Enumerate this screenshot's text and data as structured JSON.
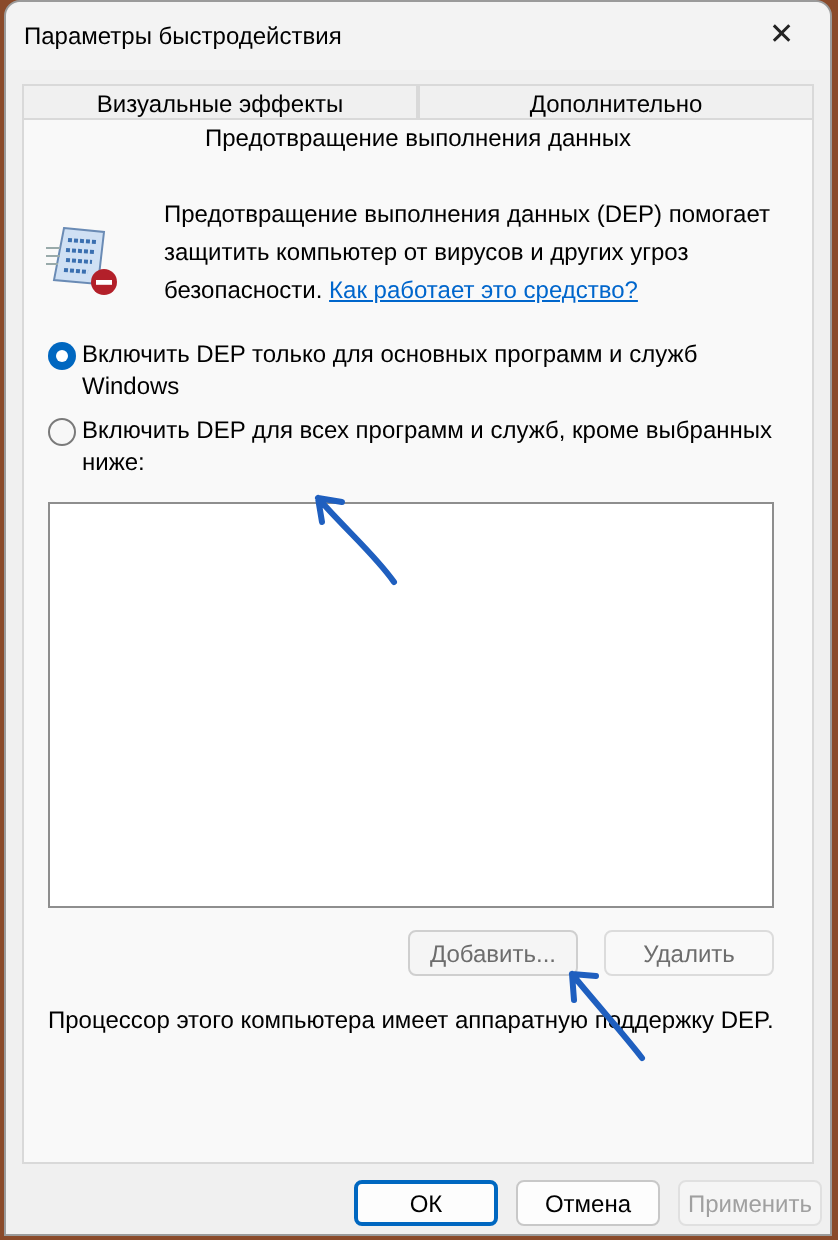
{
  "window": {
    "title": "Параметры быстродействия",
    "close": "✕"
  },
  "tab_rows": [
    [
      {
        "label": "Визуальные эффекты",
        "selected": false
      },
      {
        "label": "Дополнительно",
        "selected": false
      }
    ],
    [
      {
        "label": "Предотвращение выполнения данных",
        "selected": true
      }
    ]
  ],
  "description": {
    "text": "Предотвращение выполнения данных (DEP) помогает защитить компьютер от вирусов и других угроз безопасности.",
    "link": "Как работает это средство?"
  },
  "options": [
    {
      "label": "Включить DEP только для основных программ и служб Windows",
      "selected": true
    },
    {
      "label": "Включить DEP для всех программ и служб, кроме выбранных ниже:",
      "selected": false
    }
  ],
  "list_buttons": [
    {
      "label": "Добавить...",
      "disabled": false,
      "focused": true
    },
    {
      "label": "Удалить",
      "disabled": false,
      "focused": false
    }
  ],
  "status": "Процессор этого компьютера имеет аппаратную поддержку DEP.",
  "footer_buttons": [
    {
      "label": "ОК",
      "default": true,
      "disabled": false
    },
    {
      "label": "Отмена",
      "default": false,
      "disabled": false
    },
    {
      "label": "Применить",
      "default": false,
      "disabled": true
    }
  ]
}
